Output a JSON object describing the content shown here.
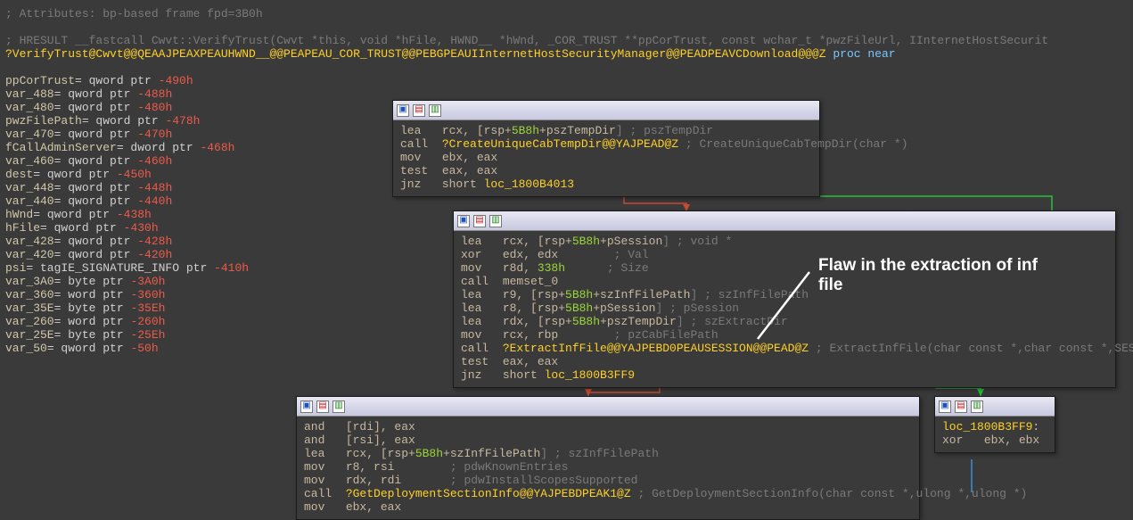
{
  "attributes_comment": "; Attributes: bp-based frame fpd=3B0h",
  "signature_comment": "; HRESULT __fastcall Cwvt::VerifyTrust(Cwvt *this, void *hFile, HWND__ *hWnd, _COR_TRUST **ppCorTrust, const wchar_t *pwzFileUrl, IInternetHostSecurit",
  "proc_name": "?VerifyTrust@Cwvt@@QEAAJPEAXPEAUHWND__@@PEAPEAU_COR_TRUST@@PEBGPEAUIInternetHostSecurityManager@@PEADPEAVCDownload@@@Z",
  "proc_kw1": "proc",
  "proc_kw2": "near",
  "locals": [
    {
      "n": "ppCorTrust",
      "t": "qword ptr",
      "o": "-490h"
    },
    {
      "n": "var_488",
      "t": "qword ptr",
      "o": "-488h"
    },
    {
      "n": "var_480",
      "t": "qword ptr",
      "o": "-480h"
    },
    {
      "n": "pwzFilePath",
      "t": "qword ptr",
      "o": "-478h"
    },
    {
      "n": "var_470",
      "t": "qword ptr",
      "o": "-470h"
    },
    {
      "n": "fCallAdminServer",
      "t": "dword ptr",
      "o": "-468h"
    },
    {
      "n": "var_460",
      "t": "qword ptr",
      "o": "-460h"
    },
    {
      "n": "dest",
      "t": "qword ptr",
      "o": "-450h"
    },
    {
      "n": "var_448",
      "t": "qword ptr",
      "o": "-448h"
    },
    {
      "n": "var_440",
      "t": "qword ptr",
      "o": "-440h"
    },
    {
      "n": "hWnd",
      "t": "qword ptr",
      "o": "-438h"
    },
    {
      "n": "hFile",
      "t": "qword ptr",
      "o": "-430h"
    },
    {
      "n": "var_428",
      "t": "qword ptr",
      "o": "-428h"
    },
    {
      "n": "var_420",
      "t": "qword ptr",
      "o": "-420h"
    },
    {
      "n": "psi",
      "t": "tagIE_SIGNATURE_INFO ptr",
      "o": "-410h"
    },
    {
      "n": "var_3A0",
      "t": "byte ptr",
      "o": "-3A0h"
    },
    {
      "n": "var_360",
      "t": "word ptr",
      "o": "-360h"
    },
    {
      "n": "var_35E",
      "t": "byte ptr",
      "o": "-35Eh"
    },
    {
      "n": "var_260",
      "t": "word ptr",
      "o": "-260h"
    },
    {
      "n": "var_25E",
      "t": "byte ptr",
      "o": "-25Eh"
    },
    {
      "n": "var_50",
      "t": "qword ptr",
      "o": "-50h"
    }
  ],
  "pane1": {
    "lines": [
      {
        "m": "lea",
        "ops": "rcx, [rsp+",
        "off": "5B8h",
        "sym": "+pszTempDir",
        "tail": "] ; pszTempDir"
      },
      {
        "m": "call",
        "func": "?CreateUniqueCabTempDir@@YAJPEAD@Z",
        "cmt": " ; CreateUniqueCabTempDir(char *)"
      },
      {
        "m": "mov",
        "ops": "ebx, eax"
      },
      {
        "m": "test",
        "ops": "eax, eax"
      },
      {
        "m": "jnz",
        "target": "short loc_1800B4013"
      }
    ]
  },
  "pane2": {
    "lines": [
      {
        "m": "lea",
        "ops": "rcx, [rsp+",
        "off": "5B8h",
        "sym": "+pSession",
        "tail": "] ; void *"
      },
      {
        "m": "xor",
        "ops": "edx, edx",
        "cmt": "        ; Val"
      },
      {
        "m": "mov",
        "ops": "r8d, ",
        "num": "338h",
        "cmt": "      ; Size"
      },
      {
        "m": "call",
        "plain": "memset_0"
      },
      {
        "m": "lea",
        "ops": "r9, [rsp+",
        "off": "5B8h",
        "sym": "+szInfFilePath",
        "tail": "] ; szInfFilePath"
      },
      {
        "m": "lea",
        "ops": "r8, [rsp+",
        "off": "5B8h",
        "sym": "+pSession",
        "tail": "] ; pSession"
      },
      {
        "m": "lea",
        "ops": "rdx, [rsp+",
        "off": "5B8h",
        "sym": "+pszTempDir",
        "tail": "] ; szExtractDir"
      },
      {
        "m": "mov",
        "ops": "rcx, rbp",
        "cmt": "        ; pzCabFilePath"
      },
      {
        "m": "call",
        "func": "?ExtractInfFile@@YAJPEBD0PEAUSESSION@@PEAD@Z",
        "cmt": " ; ExtractInfFile(char const *,char const *,SESSION *,char *)"
      },
      {
        "m": "test",
        "ops": "eax, eax"
      },
      {
        "m": "jnz",
        "target": "short loc_1800B3FF9"
      }
    ]
  },
  "pane3": {
    "lines": [
      {
        "m": "and",
        "ops": "[rdi], eax"
      },
      {
        "m": "and",
        "ops": "[rsi], eax"
      },
      {
        "m": "lea",
        "ops": "rcx, [rsp+",
        "off": "5B8h",
        "sym": "+szInfFilePath",
        "tail": "] ; szInfFilePath"
      },
      {
        "m": "mov",
        "ops": "r8, rsi",
        "cmt": "        ; pdwKnownEntries"
      },
      {
        "m": "mov",
        "ops": "rdx, rdi",
        "cmt": "       ; pdwInstallScopesSupported"
      },
      {
        "m": "call",
        "func": "?GetDeploymentSectionInfo@@YAJPEBDPEAK1@Z",
        "cmt": " ; GetDeploymentSectionInfo(char const *,ulong *,ulong *)"
      },
      {
        "m": "mov",
        "ops": "ebx, eax"
      }
    ]
  },
  "pane4": {
    "label": "loc_1800B3FF9",
    "m": "xor",
    "ops": "ebx, ebx"
  },
  "annotation": {
    "line1": "Flaw in the extraction of inf",
    "line2": "file"
  }
}
